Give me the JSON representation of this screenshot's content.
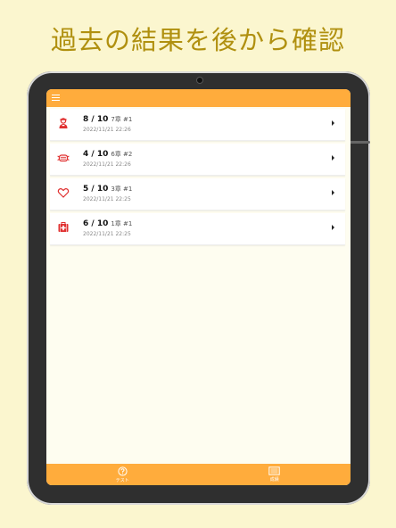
{
  "headline": "過去の結果を後から確認",
  "app": {
    "menu_icon": "hamburger-menu-icon",
    "results": [
      {
        "icon": "firefighter-icon",
        "score": "8 / 10",
        "chapter": "7章 #1",
        "date": "2022/11/21 22:26"
      },
      {
        "icon": "mask-icon",
        "score": "4 / 10",
        "chapter": "6章 #2",
        "date": "2022/11/21 22:26"
      },
      {
        "icon": "heart-outline-icon",
        "score": "5 / 10",
        "chapter": "3章 #1",
        "date": "2022/11/21 22:25"
      },
      {
        "icon": "first-aid-kit-icon",
        "score": "6 / 10",
        "chapter": "1章 #1",
        "date": "2022/11/21 22:25"
      }
    ],
    "tabs": [
      {
        "label": "テスト",
        "icon": "question-circle-icon"
      },
      {
        "label": "成績",
        "icon": "report-card-icon"
      }
    ],
    "colors": {
      "accent": "#ffac3c",
      "icon_red": "#e03030",
      "headline": "#b0900f",
      "background": "#fbf6cf"
    }
  }
}
